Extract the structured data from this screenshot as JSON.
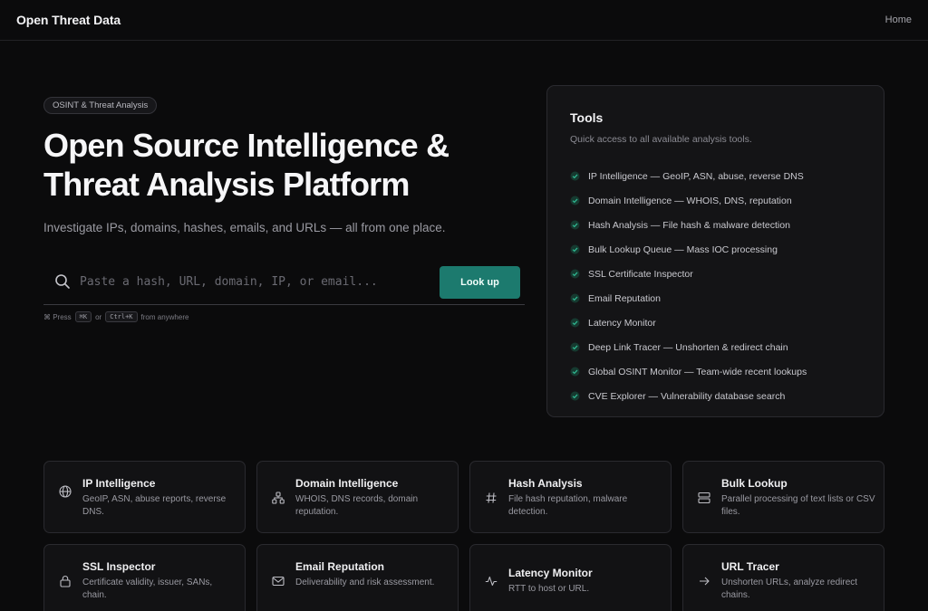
{
  "header": {
    "brand": "Open Threat Data",
    "nav_home": "Home"
  },
  "hero": {
    "badge": "OSINT & Threat Analysis",
    "title": "Open Source Intelligence & Threat Analysis Platform",
    "subtitle": "Investigate IPs, domains, hashes, emails, and URLs — all from one place."
  },
  "search": {
    "placeholder": "Paste a hash, URL, domain, IP, or email...",
    "value": "",
    "button_label": "Look up",
    "hint_prefix": "⌘ Press",
    "hint_key1": "⌘K",
    "hint_or": "or",
    "hint_key2": "Ctrl+K",
    "hint_suffix": "from anywhere"
  },
  "tools": {
    "title": "Tools",
    "subtitle": "Quick access to all available analysis tools.",
    "items": [
      {
        "label": "IP Intelligence — GeoIP, ASN, abuse, reverse DNS"
      },
      {
        "label": "Domain Intelligence — WHOIS, DNS, reputation"
      },
      {
        "label": "Hash Analysis — File hash & malware detection"
      },
      {
        "label": "Bulk Lookup Queue — Mass IOC processing"
      },
      {
        "label": "SSL Certificate Inspector"
      },
      {
        "label": "Email Reputation"
      },
      {
        "label": "Latency Monitor"
      },
      {
        "label": "Deep Link Tracer — Unshorten & redirect chain"
      },
      {
        "label": "Global OSINT Monitor — Team-wide recent lookups"
      },
      {
        "label": "CVE Explorer — Vulnerability database search"
      }
    ]
  },
  "cards": [
    {
      "title": "IP Intelligence",
      "description": "GeoIP, ASN, abuse reports, reverse DNS.",
      "icon": "globe-icon"
    },
    {
      "title": "Domain Intelligence",
      "description": "WHOIS, DNS records, domain reputation.",
      "icon": "network-icon"
    },
    {
      "title": "Hash Analysis",
      "description": "File hash reputation, malware detection.",
      "icon": "hash-icon"
    },
    {
      "title": "Bulk Lookup",
      "description": "Parallel processing of text lists or CSV files.",
      "icon": "server-icon"
    },
    {
      "title": "SSL Inspector",
      "description": "Certificate validity, issuer, SANs, chain.",
      "icon": "lock-icon"
    },
    {
      "title": "Email Reputation",
      "description": "Deliverability and risk assessment.",
      "icon": "mail-icon"
    },
    {
      "title": "Latency Monitor",
      "description": "RTT to host or URL.",
      "icon": "pulse-icon"
    },
    {
      "title": "URL Tracer",
      "description": "Unshorten URLs, analyze redirect chains.",
      "icon": "arrow-right-icon"
    }
  ],
  "colors": {
    "accent": "#1c7a6e",
    "check": "#2fb58f",
    "background": "#0b0b0c"
  }
}
